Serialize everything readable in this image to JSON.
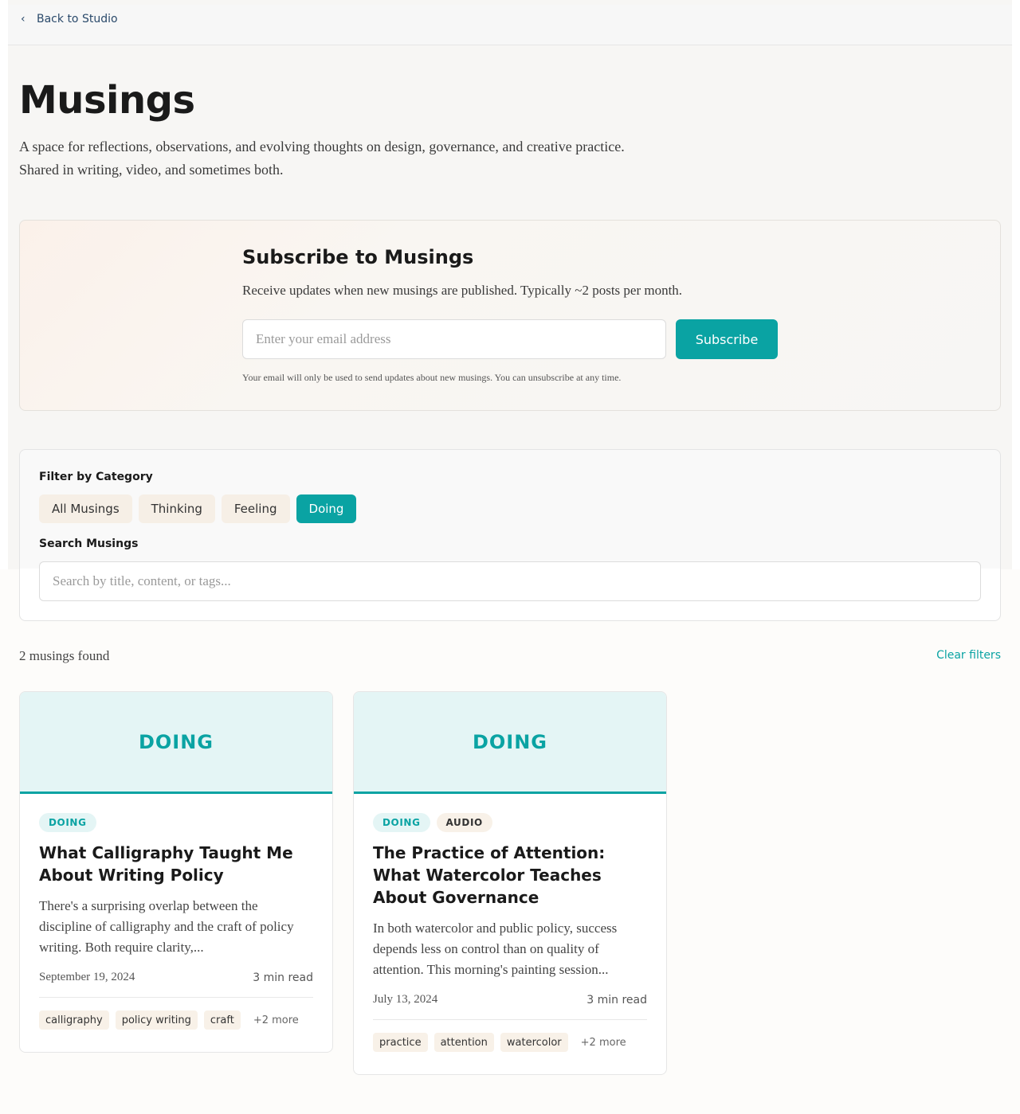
{
  "nav": {
    "back_label": "Back to Studio"
  },
  "header": {
    "title": "Musings",
    "subtitle": "A space for reflections, observations, and evolving thoughts on design, governance, and creative practice. Shared in writing, video, and sometimes both."
  },
  "subscribe": {
    "title": "Subscribe to Musings",
    "description": "Receive updates when new musings are published. Typically ~2 posts per month.",
    "email_placeholder": "Enter your email address",
    "button_label": "Subscribe",
    "note": "Your email will only be used to send updates about new musings. You can unsubscribe at any time."
  },
  "filters": {
    "category_label": "Filter by Category",
    "categories": [
      {
        "label": "All Musings",
        "active": false
      },
      {
        "label": "Thinking",
        "active": false
      },
      {
        "label": "Feeling",
        "active": false
      },
      {
        "label": "Doing",
        "active": true
      }
    ],
    "search_label": "Search Musings",
    "search_placeholder": "Search by title, content, or tags..."
  },
  "results": {
    "count_text": "2 musings found",
    "clear_label": "Clear filters"
  },
  "cards": [
    {
      "hero_label": "DOING",
      "badges": [
        "DOING"
      ],
      "title": "What Calligraphy Taught Me About Writing Policy",
      "excerpt": "There's a surprising overlap between the discipline of calligraphy and the craft of policy writing. Both require clarity,...",
      "date": "September 19, 2024",
      "read_time": "3 min read",
      "tags": [
        "calligraphy",
        "policy writing",
        "craft"
      ],
      "more": "+2 more"
    },
    {
      "hero_label": "DOING",
      "badges": [
        "DOING",
        "AUDIO"
      ],
      "title": "The Practice of Attention: What Watercolor Teaches About Governance",
      "excerpt": "In both watercolor and public policy, success depends less on control than on quality of attention. This morning's painting session...",
      "date": "July 13, 2024",
      "read_time": "3 min read",
      "tags": [
        "practice",
        "attention",
        "watercolor"
      ],
      "more": "+2 more"
    }
  ],
  "colors": {
    "accent": "#0aa3a3",
    "chip_bg": "#f6efe6",
    "hero_bg": "#e4f5f5"
  }
}
